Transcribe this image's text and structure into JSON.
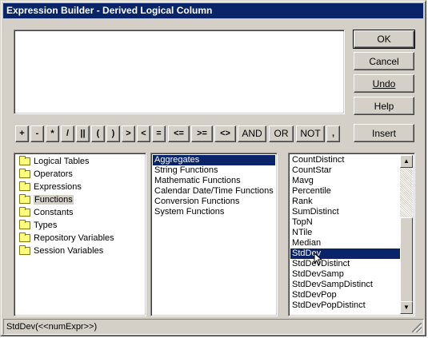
{
  "window": {
    "title": "Expression Builder - Derived Logical Column"
  },
  "buttons": {
    "ok": "OK",
    "cancel": "Cancel",
    "undo": "Undo",
    "help": "Help",
    "insert": "Insert"
  },
  "operators": [
    "+",
    "-",
    "*",
    "/",
    "||",
    "(",
    ")",
    ">",
    "<",
    "=",
    "<=",
    ">=",
    "<>",
    "AND",
    "OR",
    "NOT",
    ","
  ],
  "categories": [
    {
      "label": "Logical Tables",
      "icon": "folder-icon"
    },
    {
      "label": "Operators",
      "icon": "folder-icon"
    },
    {
      "label": "Expressions",
      "icon": "folder-icon"
    },
    {
      "label": "Functions",
      "icon": "folder-icon",
      "selected": true
    },
    {
      "label": "Constants",
      "icon": "folder-icon"
    },
    {
      "label": "Types",
      "icon": "folder-icon"
    },
    {
      "label": "Repository Variables",
      "icon": "folder-icon"
    },
    {
      "label": "Session Variables",
      "icon": "folder-icon"
    }
  ],
  "function_groups": [
    {
      "label": "Aggregates",
      "selected": true
    },
    {
      "label": "String Functions"
    },
    {
      "label": "Mathematic Functions"
    },
    {
      "label": "Calendar Date/Time Functions"
    },
    {
      "label": "Conversion Functions"
    },
    {
      "label": "System Functions"
    }
  ],
  "functions": [
    {
      "label": "CountDistinct"
    },
    {
      "label": "CountStar"
    },
    {
      "label": "Mavg"
    },
    {
      "label": "Percentile"
    },
    {
      "label": "Rank"
    },
    {
      "label": "SumDistinct"
    },
    {
      "label": "TopN"
    },
    {
      "label": "NTile"
    },
    {
      "label": "Median"
    },
    {
      "label": "StdDev",
      "selected": true
    },
    {
      "label": "StdDevDistinct"
    },
    {
      "label": "StdDevSamp"
    },
    {
      "label": "StdDevSampDistinct"
    },
    {
      "label": "StdDevPop"
    },
    {
      "label": "StdDevPopDistinct"
    }
  ],
  "expression": {
    "value": ""
  },
  "status": {
    "text": "StdDev(<<numExpr>>)"
  },
  "colors": {
    "titlebar": "#0a246a",
    "selection": "#0a246a",
    "face": "#d4d0c8"
  }
}
